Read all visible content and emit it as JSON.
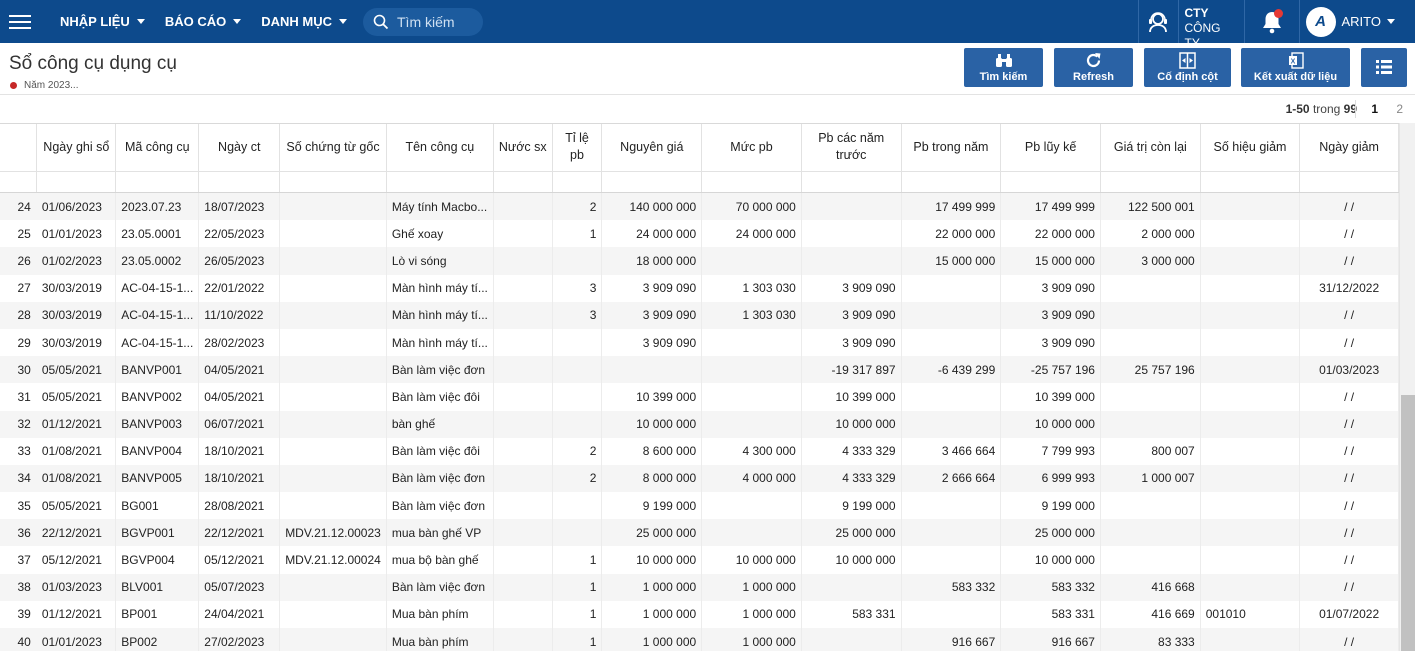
{
  "topbar": {
    "menus": [
      {
        "label": "NHẬP LIỆU"
      },
      {
        "label": "BÁO CÁO"
      },
      {
        "label": "DANH MỤC"
      }
    ],
    "search_placeholder": "Tìm kiếm",
    "company_line1": "CTY",
    "company_line2": "CÔNG TY",
    "user_name": "ARITO",
    "avatar_text": "A"
  },
  "page": {
    "title": "Sổ công cụ dụng cụ",
    "subtitle": "Năm 2023..."
  },
  "toolbar": {
    "search_label": "Tìm kiếm",
    "refresh_label": "Refresh",
    "fix_col_label": "Cố định cột",
    "export_label": "Kết xuất dữ liệu"
  },
  "pager": {
    "range": "1-50",
    "of_label": "trong",
    "total": "99",
    "page1": "1",
    "page2": "2"
  },
  "table": {
    "headers": [
      "Ngày ghi sổ",
      "Mã công cụ",
      "Ngày ct",
      "Số chứng từ gốc",
      "Tên công cụ",
      "Nước sx",
      "Tỉ lệ pb",
      "Nguyên giá",
      "Mức pb",
      "Pb các năm trước",
      "Pb trong năm",
      "Pb lũy kế",
      "Giá trị còn lại",
      "Số hiệu giảm",
      "Ngày giảm"
    ],
    "rows": [
      {
        "n": "24",
        "c": [
          "01/06/2023",
          "2023.07.23",
          "18/07/2023",
          "",
          "Máy tính Macbo...",
          "",
          "2",
          "140 000 000",
          "70 000 000",
          "",
          "17 499 999",
          "17 499 999",
          "122 500 001",
          "",
          "/ /"
        ]
      },
      {
        "n": "25",
        "c": [
          "01/01/2023",
          "23.05.0001",
          "22/05/2023",
          "",
          "Ghế xoay",
          "",
          "1",
          "24 000 000",
          "24 000 000",
          "",
          "22 000 000",
          "22 000 000",
          "2 000 000",
          "",
          "/ /"
        ]
      },
      {
        "n": "26",
        "c": [
          "01/02/2023",
          "23.05.0002",
          "26/05/2023",
          "",
          "Lò vi sóng",
          "",
          "",
          "18 000 000",
          "",
          "",
          "15 000 000",
          "15 000 000",
          "3 000 000",
          "",
          "/ /"
        ]
      },
      {
        "n": "27",
        "c": [
          "30/03/2019",
          "AC-04-15-1...",
          "22/01/2022",
          "",
          "Màn hình máy tí...",
          "",
          "3",
          "3 909 090",
          "1 303 030",
          "3 909 090",
          "",
          "3 909 090",
          "",
          "",
          "31/12/2022"
        ]
      },
      {
        "n": "28",
        "c": [
          "30/03/2019",
          "AC-04-15-1...",
          "11/10/2022",
          "",
          "Màn hình máy tí...",
          "",
          "3",
          "3 909 090",
          "1 303 030",
          "3 909 090",
          "",
          "3 909 090",
          "",
          "",
          "/ /"
        ]
      },
      {
        "n": "29",
        "c": [
          "30/03/2019",
          "AC-04-15-1...",
          "28/02/2023",
          "",
          "Màn hình máy tí...",
          "",
          "",
          "3 909 090",
          "",
          "3 909 090",
          "",
          "3 909 090",
          "",
          "",
          "/ /"
        ]
      },
      {
        "n": "30",
        "c": [
          "05/05/2021",
          "BANVP001",
          "04/05/2021",
          "",
          "Bàn làm việc đơn",
          "",
          "",
          "",
          "",
          "-19 317 897",
          "-6 439 299",
          "-25 757 196",
          "25 757 196",
          "",
          "01/03/2023"
        ]
      },
      {
        "n": "31",
        "c": [
          "05/05/2021",
          "BANVP002",
          "04/05/2021",
          "",
          "Bàn làm việc đôi",
          "",
          "",
          "10 399 000",
          "",
          "10 399 000",
          "",
          "10 399 000",
          "",
          "",
          "/ /"
        ]
      },
      {
        "n": "32",
        "c": [
          "01/12/2021",
          "BANVP003",
          "06/07/2021",
          "",
          "bàn ghế",
          "",
          "",
          "10 000 000",
          "",
          "10 000 000",
          "",
          "10 000 000",
          "",
          "",
          "/ /"
        ]
      },
      {
        "n": "33",
        "c": [
          "01/08/2021",
          "BANVP004",
          "18/10/2021",
          "",
          "Bàn làm việc đôi",
          "",
          "2",
          "8 600 000",
          "4 300 000",
          "4 333 329",
          "3 466 664",
          "7 799 993",
          "800 007",
          "",
          "/ /"
        ]
      },
      {
        "n": "34",
        "c": [
          "01/08/2021",
          "BANVP005",
          "18/10/2021",
          "",
          "Bàn làm việc đơn",
          "",
          "2",
          "8 000 000",
          "4 000 000",
          "4 333 329",
          "2 666 664",
          "6 999 993",
          "1 000 007",
          "",
          "/ /"
        ]
      },
      {
        "n": "35",
        "c": [
          "05/05/2021",
          "BG001",
          "28/08/2021",
          "",
          "Bàn làm việc đơn",
          "",
          "",
          "9 199 000",
          "",
          "9 199 000",
          "",
          "9 199 000",
          "",
          "",
          "/ /"
        ]
      },
      {
        "n": "36",
        "c": [
          "22/12/2021",
          "BGVP001",
          "22/12/2021",
          "MDV.21.12.00023",
          "mua bàn ghế VP",
          "",
          "",
          "25 000 000",
          "",
          "25 000 000",
          "",
          "25 000 000",
          "",
          "",
          "/ /"
        ]
      },
      {
        "n": "37",
        "c": [
          "05/12/2021",
          "BGVP004",
          "05/12/2021",
          "MDV.21.12.00024",
          "mua bộ bàn ghế",
          "",
          "1",
          "10 000 000",
          "10 000 000",
          "10 000 000",
          "",
          "10 000 000",
          "",
          "",
          "/ /"
        ]
      },
      {
        "n": "38",
        "c": [
          "01/03/2023",
          "BLV001",
          "05/07/2023",
          "",
          "Bàn làm việc đơn",
          "",
          "1",
          "1 000 000",
          "1 000 000",
          "",
          "583 332",
          "583 332",
          "416 668",
          "",
          "/ /"
        ]
      },
      {
        "n": "39",
        "c": [
          "01/12/2021",
          "BP001",
          "24/04/2021",
          "",
          "Mua bàn phím",
          "",
          "1",
          "1 000 000",
          "1 000 000",
          "583 331",
          "",
          "583 331",
          "416 669",
          "001010",
          "01/07/2022"
        ]
      },
      {
        "n": "40",
        "c": [
          "01/01/2023",
          "BP002",
          "27/02/2023",
          "",
          "Mua bàn phím",
          "",
          "1",
          "1 000 000",
          "1 000 000",
          "",
          "916 667",
          "916 667",
          "83 333",
          "",
          "/ /"
        ]
      }
    ]
  }
}
